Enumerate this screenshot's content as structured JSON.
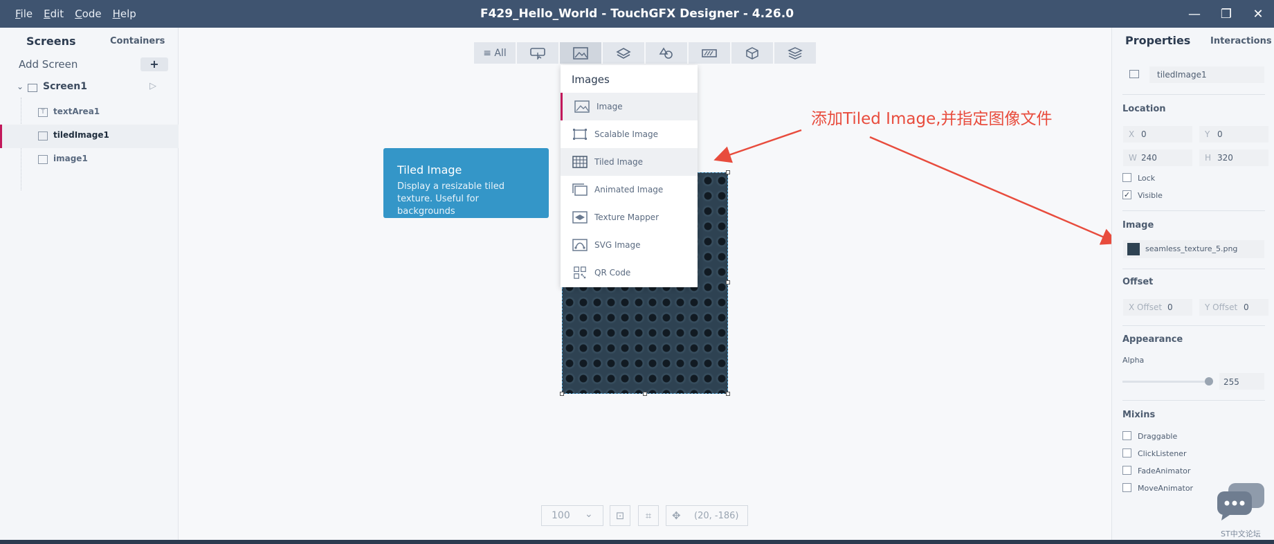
{
  "window": {
    "title": "F429_Hello_World - TouchGFX Designer - 4.26.0",
    "menu": [
      "File",
      "Edit",
      "Code",
      "Help"
    ],
    "controls": {
      "minimize": "—",
      "restore": "❐",
      "close": "✕"
    }
  },
  "left_panel": {
    "tabs": {
      "screens": "Screens",
      "containers": "Containers"
    },
    "add_screen": "Add Screen",
    "add_button": "+",
    "screen": {
      "name": "Screen1",
      "expand_icon": "chevron-down-icon",
      "play_icon": "play-icon"
    },
    "widgets": [
      {
        "name": "textArea1",
        "icon": "text-icon",
        "selected": false
      },
      {
        "name": "tiledImage1",
        "icon": "tiled-image-icon",
        "selected": true
      },
      {
        "name": "image1",
        "icon": "image-icon",
        "selected": false
      }
    ]
  },
  "toolbar": {
    "items": [
      {
        "label": "All",
        "icon": "list-icon"
      },
      {
        "icon": "button-icon"
      },
      {
        "icon": "image-icon",
        "active": true
      },
      {
        "icon": "layers-icon"
      },
      {
        "icon": "shapes-icon"
      },
      {
        "icon": "progress-icon"
      },
      {
        "icon": "cube-icon"
      },
      {
        "icon": "stack-icon"
      }
    ]
  },
  "dropdown": {
    "header": "Images",
    "items": [
      {
        "label": "Image",
        "icon": "image-icon"
      },
      {
        "label": "Scalable Image",
        "icon": "scalable-image-icon"
      },
      {
        "label": "Tiled Image",
        "icon": "tiled-image-icon"
      },
      {
        "label": "Animated Image",
        "icon": "animated-image-icon"
      },
      {
        "label": "Texture Mapper",
        "icon": "texture-mapper-icon"
      },
      {
        "label": "SVG Image",
        "icon": "svg-image-icon"
      },
      {
        "label": "QR Code",
        "icon": "qr-code-icon"
      }
    ]
  },
  "tooltip": {
    "title": "Tiled Image",
    "description": "Display a resizable tiled texture. Useful for backgrounds"
  },
  "annotation": {
    "text": "添加Tiled Image,并指定图像文件",
    "color": "#e84c3d"
  },
  "bottom_bar": {
    "zoom": "100",
    "coords": "(20, -186)"
  },
  "right_panel": {
    "tabs": {
      "properties": "Properties",
      "interactions": "Interactions"
    },
    "widget_name": "tiledImage1",
    "location": {
      "title": "Location",
      "x_label": "X",
      "x": "0",
      "y_label": "Y",
      "y": "0",
      "w_label": "W",
      "w": "240",
      "h_label": "H",
      "h": "320",
      "lock_label": "Lock",
      "lock": false,
      "visible_label": "Visible",
      "visible": true
    },
    "image": {
      "title": "Image",
      "file": "seamless_texture_5.png"
    },
    "offset": {
      "title": "Offset",
      "x_label": "X Offset",
      "x": "0",
      "y_label": "Y Offset",
      "y": "0"
    },
    "appearance": {
      "title": "Appearance",
      "alpha_label": "Alpha",
      "alpha": "255",
      "alpha_fraction": 1.0
    },
    "mixins": {
      "title": "Mixins",
      "items": [
        "Draggable",
        "ClickListener",
        "FadeAnimator",
        "MoveAnimator"
      ]
    }
  },
  "watermark": "ST中文论坛",
  "colors": {
    "titlebar": "#3f5470",
    "accent": "#c2185b",
    "tooltip": "#3496c8"
  }
}
